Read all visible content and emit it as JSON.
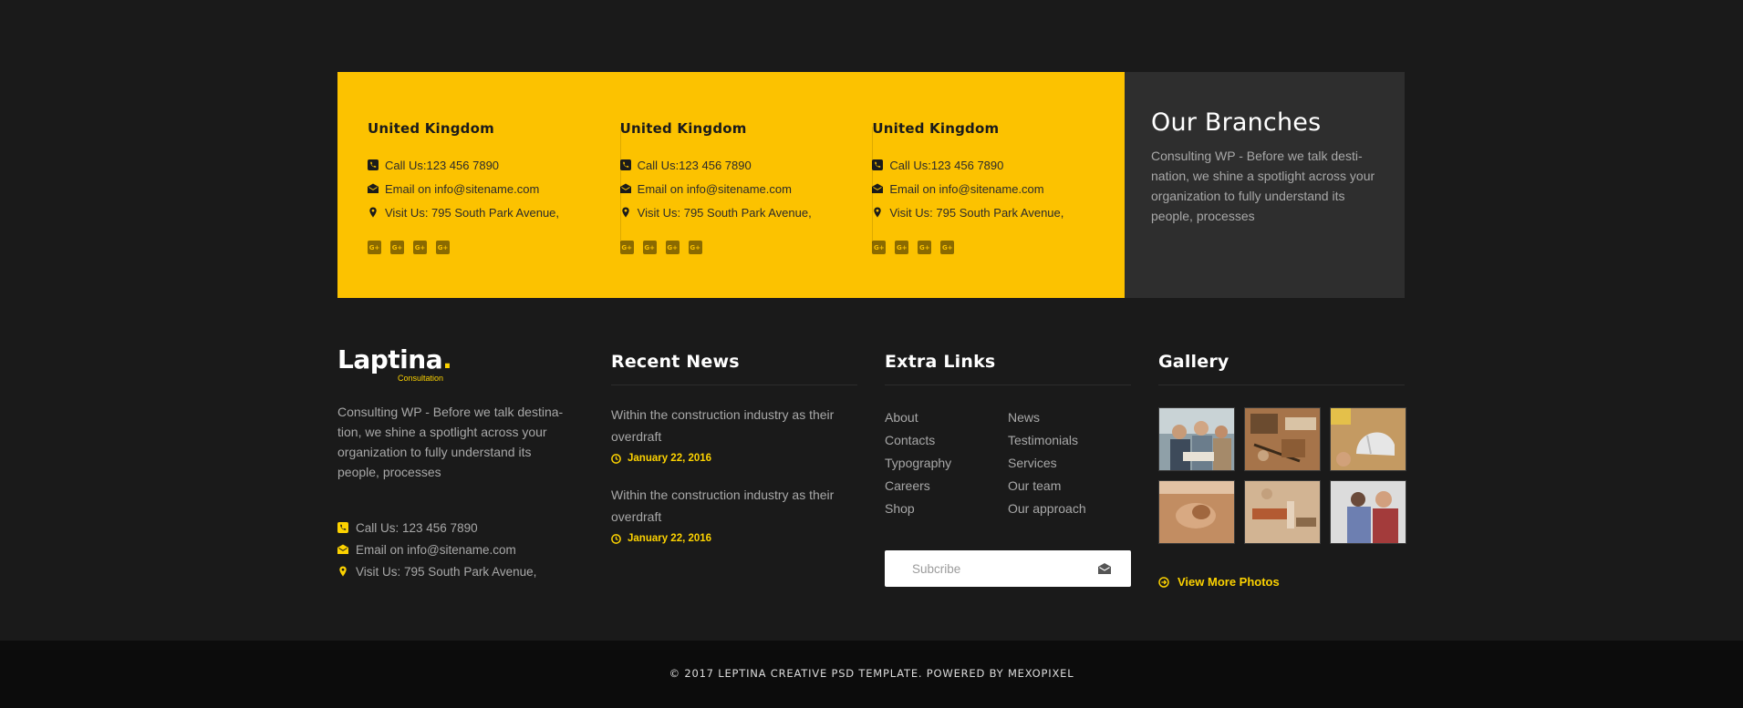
{
  "branches": {
    "items": [
      {
        "title": "United Kingdom",
        "phone": "Call Us:123 456 7890",
        "email": "Email on info@sitename.com",
        "address": "Visit Us: 795 South Park Avenue,"
      },
      {
        "title": "United Kingdom",
        "phone": "Call Us:123 456 7890",
        "email": "Email on info@sitename.com",
        "address": "Visit Us: 795 South Park Avenue,"
      },
      {
        "title": "United Kingdom",
        "phone": "Call Us:123 456 7890",
        "email": "Email on info@sitename.com",
        "address": "Visit Us: 795 South Park Avenue,"
      }
    ],
    "social_icon": "G+",
    "heading": "Our Branches",
    "description": "Consulting WP - Before we talk desti-nation, we shine a spotlight across your organization to fully understand its people, processes"
  },
  "about": {
    "logo_text": "Laptina",
    "logo_dot": ".",
    "logo_sub": "Consultation",
    "text": "Consulting WP - Before we talk destina-tion, we shine a spotlight across your organization to fully understand its people, processes",
    "phone": "Call Us: 123 456 7890",
    "email": "Email on info@sitename.com",
    "address": "Visit Us: 795 South Park Avenue,"
  },
  "news": {
    "title": "Recent News",
    "items": [
      {
        "title": "Within the construction industry as their overdraft",
        "date": "January 22, 2016"
      },
      {
        "title": "Within the construction industry as their overdraft",
        "date": "January 22, 2016"
      }
    ]
  },
  "links": {
    "title": "Extra Links",
    "left": [
      "About",
      "Contacts",
      "Typography",
      "Careers",
      "Shop"
    ],
    "right": [
      "News",
      "Testimonials",
      "Services",
      "Our team",
      "Our approach"
    ],
    "subscribe_placeholder": "Subcribe"
  },
  "gallery": {
    "title": "Gallery",
    "more_label": "View More Photos"
  },
  "footer": {
    "copyright": "© 2017 LEPTINA CREATIVE PSD TEMPLATE. POWERED BY MEXOPIXEL"
  },
  "colors": {
    "accent": "#fcc200",
    "background": "#1a1a1a",
    "panel": "#2e2e2e",
    "bottom_bar": "#0c0c0c"
  }
}
